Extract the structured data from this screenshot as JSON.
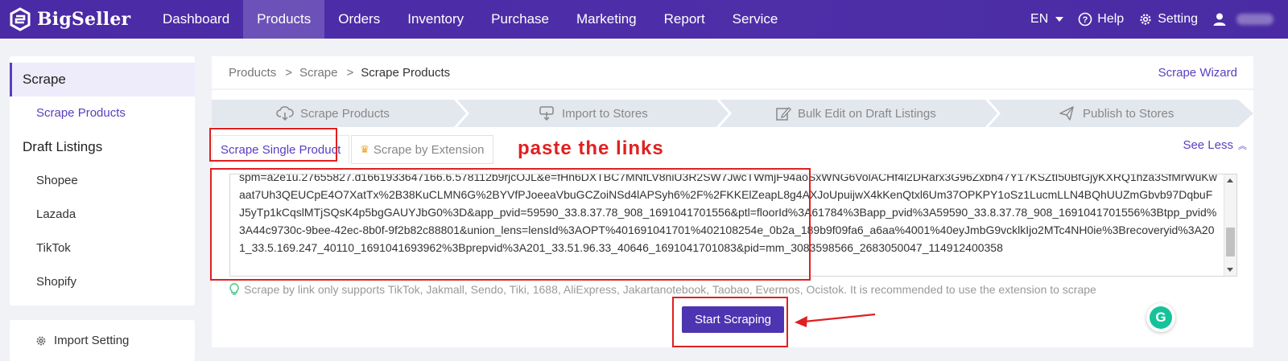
{
  "app": {
    "name": "BigSeller"
  },
  "nav": {
    "items": [
      {
        "label": "Dashboard"
      },
      {
        "label": "Products",
        "active": true
      },
      {
        "label": "Orders"
      },
      {
        "label": "Inventory"
      },
      {
        "label": "Purchase"
      },
      {
        "label": "Marketing"
      },
      {
        "label": "Report"
      },
      {
        "label": "Service"
      }
    ],
    "language": "EN",
    "help": "Help",
    "setting": "Setting"
  },
  "sidebar": {
    "scrape_group": "Scrape",
    "scrape_products": "Scrape Products",
    "draft_group": "Draft Listings",
    "draft_items": [
      "Shopee",
      "Lazada",
      "TikTok",
      "Shopify"
    ],
    "import_setting": "Import Setting"
  },
  "breadcrumb": {
    "items": [
      "Products",
      "Scrape",
      "Scrape Products"
    ],
    "separator": ">"
  },
  "scrape_wizard": "Scrape Wizard",
  "steps": [
    "Scrape Products",
    "Import to Stores",
    "Bulk Edit on Draft Listings",
    "Publish to Stores"
  ],
  "tabs": {
    "single": "Scrape Single Product",
    "extension": "Scrape by Extension"
  },
  "see_less": "See Less",
  "link_text": "spm=a2e1u.27655827.d1661933647166.6.578112b9rjcOJL&e=fHn6DXTBC7MNfLV8niU3R2SW7JwcTWmjF94aoSxWNG6VolACHf4l2DRarx3G96Zxbh47Y17KSZtI50BfGjyKXRQ1hza3SfMrWuKwaat7Uh3QEUCpE4O7XatTx%2B38KuCLMN6G%2BYVfPJoeeaVbuGCZoiNSd4lAPSyh6%2F%2FKKElZeapL8g4AXJoUpuijwX4kKenQtxl6Um37OPKPY1oSz1LucmLLN4BQhUUZmGbvb97DqbuFJ5yTp1kCqslMTjSQsK4p5bgGAUYJbG0%3D&app_pvid=59590_33.8.37.78_908_1691041701556&ptl=floorId%3A61784%3Bapp_pvid%3A59590_33.8.37.78_908_1691041701556%3Btpp_pvid%3A44c9730c-9bee-42ec-8b0f-9f2b82c88801&union_lens=lensId%3AOPT%401691041701%402108254e_0b2a_189b9f09fa6_a6aa%4001%40eyJmbG9vcklkIjo2MTc4NH0ie%3Brecoveryid%3A201_33.5.169.247_40110_1691041693962%3Bprepvid%3A201_33.51.96.33_40646_1691041701083&pid=mm_3083598566_2683050047_114912400358",
  "hint": "Scrape by link only supports TikTok, Jakmall, Sendo, Tiki, 1688, AliExpress, Jakartanotebook, Taobao, Evermos, Ocistok. It is recommended to use the extension to scrape",
  "start_button": "Start Scraping",
  "annotation": "paste the links",
  "colors": {
    "brand": "#4b2aa6",
    "accent": "#5a3ec0",
    "annotation_red": "#e02020"
  }
}
